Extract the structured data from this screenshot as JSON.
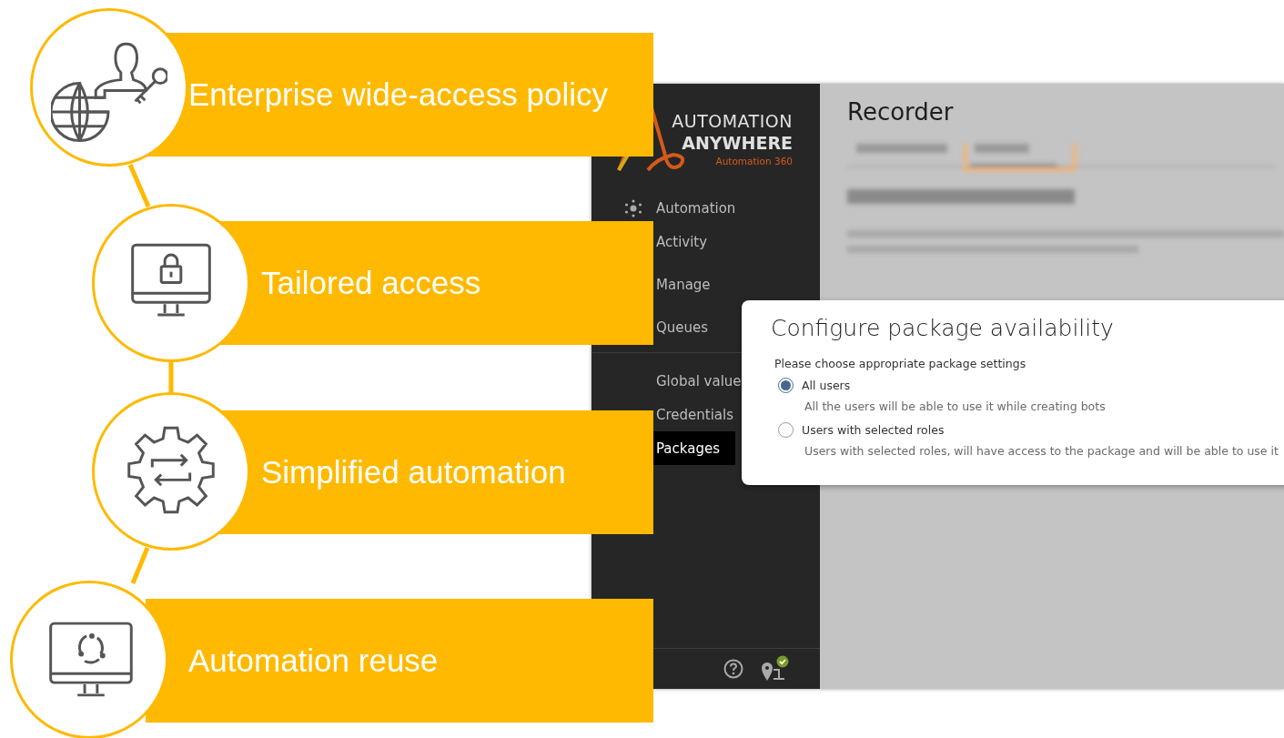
{
  "features": [
    {
      "label": "Enterprise wide-access policy",
      "kind": "globe-user-key"
    },
    {
      "label": "Tailored access",
      "kind": "monitor-lock"
    },
    {
      "label": "Simplified automation",
      "kind": "gear-arrows"
    },
    {
      "label": "Automation reuse",
      "kind": "monitor-cycle"
    }
  ],
  "app": {
    "logo": {
      "line_1": "AUTOMATION",
      "line_2": "ANYWHERE",
      "line_3": "Automation 360"
    },
    "sidebar": {
      "groups": [
        [
          {
            "label": "Automation",
            "icon": true,
            "selected": false
          },
          {
            "label": "Activity",
            "icon": false,
            "selected": false
          },
          {
            "label": "Manage",
            "icon": false,
            "selected": false
          },
          {
            "label": "Queues",
            "icon": false,
            "selected": false
          }
        ],
        [
          {
            "label": "Global value",
            "icon": false,
            "selected": false
          },
          {
            "label": "Credentials",
            "icon": false,
            "selected": false
          },
          {
            "label": "Packages",
            "icon": false,
            "selected": true
          }
        ]
      ]
    },
    "page_title": "Recorder",
    "dialog": {
      "title": "Configure package availability",
      "prompt": "Please choose appropriate package settings",
      "options": [
        {
          "label": "All users",
          "description": "All the users will be able to use it while creating bots",
          "selected": true
        },
        {
          "label": "Users with selected roles",
          "description": "Users with selected roles, will have access to the package and will be able to use it",
          "selected": false
        }
      ]
    }
  }
}
